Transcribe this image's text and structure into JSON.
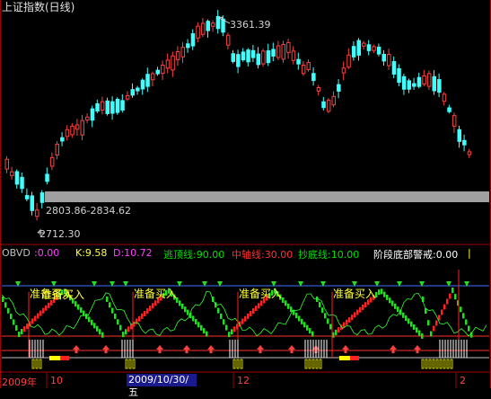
{
  "window": {
    "title": "上证指数(日线)"
  },
  "price_panel": {
    "high_label": "3361.39",
    "low_label": "2712.30",
    "band_label": "2803.86-2834.62"
  },
  "indicator": {
    "name": "OBVD",
    "obvd": ":0.00",
    "k": "K:9.58",
    "d": "D:10.72",
    "escape_line": "逃顶线:90.00",
    "mid_line": "中轴线:30.00",
    "bottom_line": "抄底线:10.00",
    "warning": "阶段底部警戒:0.00"
  },
  "signals": [
    "准备买入",
    "准备买入",
    "准备买入",
    "准备买入",
    "准备买入"
  ],
  "time_axis": {
    "label_year": "2009年",
    "label_10": "10",
    "cursor_date": "2009/10/30/五",
    "label_12": "12",
    "label_2": "2"
  },
  "colors": {
    "up": "#ff4040",
    "down": "#40ffff",
    "band": "#a0a0a0",
    "escape": "#00c000",
    "mid": "#ff3030",
    "bottom": "#ffff00",
    "signal": "#ffff33"
  }
}
